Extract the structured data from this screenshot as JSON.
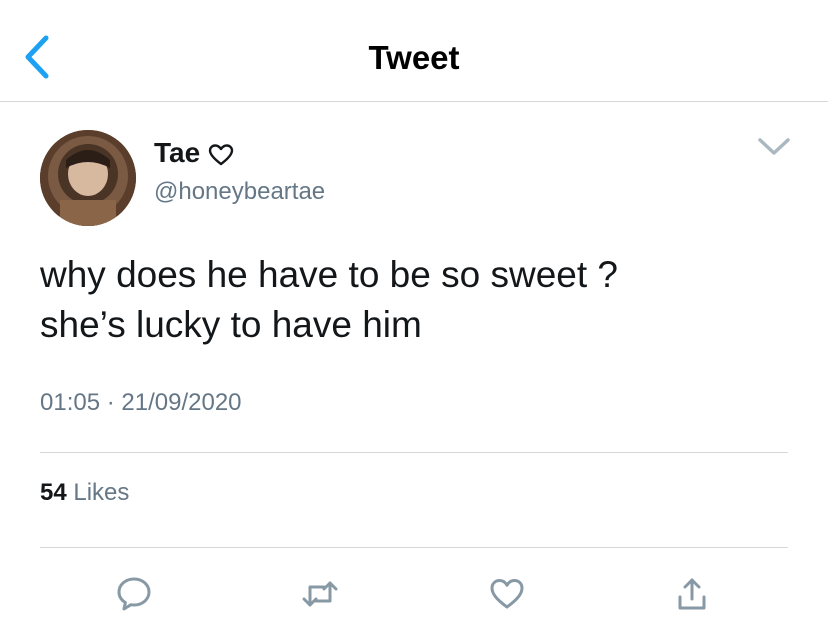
{
  "header": {
    "title": "Tweet"
  },
  "author": {
    "name": "Tae",
    "handle": "@honeybeartae"
  },
  "tweet": {
    "lines": [
      "why does he have to be so sweet ?",
      "she’s lucky to have him"
    ],
    "time": "01:05",
    "separator": "·",
    "date": "21/09/2020"
  },
  "stats": {
    "likes_count": "54",
    "likes_label": "Likes"
  },
  "icons": {
    "back": "chevron-left-icon",
    "name_badge": "heart-outline-icon",
    "more": "chevron-down-icon",
    "reply": "speech-bubble-icon",
    "retweet": "retweet-icon",
    "like": "heart-outline-icon",
    "share": "share-upload-icon"
  },
  "colors": {
    "accent": "#1da1f2",
    "text_primary": "#14171a",
    "text_secondary": "#657786",
    "icon_gray": "#8899a6",
    "divider": "#d8d8d8"
  }
}
